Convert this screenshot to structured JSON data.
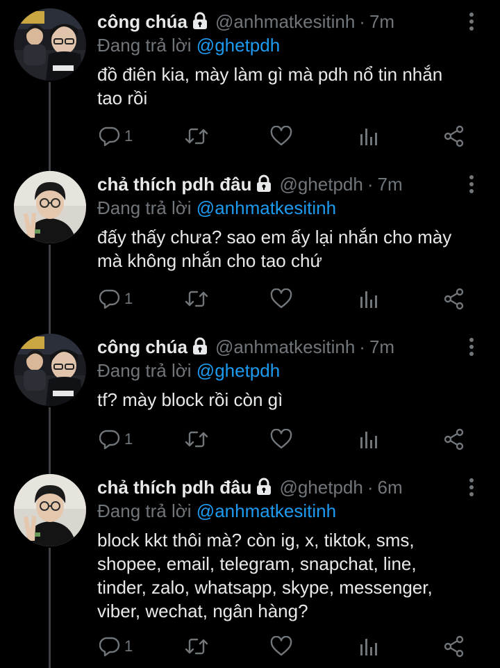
{
  "tweets": [
    {
      "name": "công chúa",
      "handle": "@anhmatkesitinh",
      "dot": "·",
      "time": "7m",
      "reply_prefix": "Đang trả lời",
      "reply_to": "@ghetpdh",
      "body": [
        "đồ điên kia, mày làm gì mà pdh nổ tin nhắn",
        "tao rồi"
      ],
      "reply_count": "1",
      "avatar_icon": "avatar-photo-gaming"
    },
    {
      "name": "chả thích pdh đâu",
      "handle": "@ghetpdh",
      "dot": "·",
      "time": "7m",
      "reply_prefix": "Đang trả lời",
      "reply_to": "@anhmatkesitinh",
      "body": [
        "đấy thấy chưa? sao em ấy lại nhắn cho mày",
        "mà không nhắn cho tao chứ"
      ],
      "reply_count": "1",
      "avatar_icon": "avatar-photo-peace"
    },
    {
      "name": "công chúa",
      "handle": "@anhmatkesitinh",
      "dot": "·",
      "time": "7m",
      "reply_prefix": "Đang trả lời",
      "reply_to": "@ghetpdh",
      "body": [
        "tf? mày block rồi còn gì"
      ],
      "reply_count": "1",
      "avatar_icon": "avatar-photo-gaming"
    },
    {
      "name": "chả thích pdh đâu",
      "handle": "@ghetpdh",
      "dot": "·",
      "time": "6m",
      "reply_prefix": "Đang trả lời",
      "reply_to": "@anhmatkesitinh",
      "body": [
        "block kkt thôi mà? còn ig, x, tiktok, sms,",
        "shopee, email, telegram, snapchat, line,",
        "tinder, zalo, whatsapp, skype, messenger,",
        "viber, wechat, ngân hàng?"
      ],
      "reply_count": "1",
      "avatar_icon": "avatar-photo-peace"
    }
  ],
  "colors": {
    "background": "#000000",
    "text": "#e7e9ea",
    "muted": "#71767b",
    "link": "#1d9bf0",
    "thread_line": "#3d4146"
  },
  "icons": [
    "lock-icon",
    "reply-icon",
    "retweet-icon",
    "like-icon",
    "views-icon",
    "share-icon",
    "more-icon"
  ]
}
